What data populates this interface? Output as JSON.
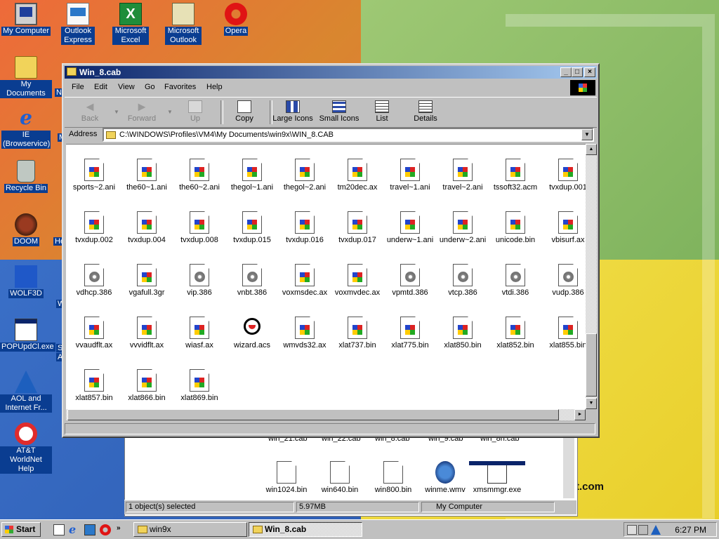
{
  "desktop": {
    "icons": [
      {
        "label": "My Computer",
        "icon": "my-computer-icon"
      },
      {
        "label": "Outlook Express",
        "icon": "outlook-express-icon"
      },
      {
        "label": "Microsoft Excel",
        "icon": "excel-icon"
      },
      {
        "label": "Microsoft Outlook",
        "icon": "outlook-icon"
      },
      {
        "label": "Opera",
        "icon": "opera-icon"
      },
      {
        "label": "My Documents",
        "icon": "my-documents-icon"
      },
      {
        "label": "IE (Browservice)",
        "icon": "ie-icon"
      },
      {
        "label": "Recycle Bin",
        "icon": "recycle-bin-icon"
      },
      {
        "label": "DOOM",
        "icon": "doom-icon"
      },
      {
        "label": "WOLF3D",
        "icon": "wolf3d-icon"
      },
      {
        "label": "POPUpdCl.exe",
        "icon": "exe-icon"
      },
      {
        "label": "AOL and Internet Fr...",
        "icon": "aol-icon"
      },
      {
        "label": "AT&T WorldNet Help",
        "icon": "att-icon"
      }
    ],
    "partial_labels": [
      "Ne",
      "He",
      "W",
      "M",
      "S",
      "A"
    ],
    "wallpaper_text": "t.com"
  },
  "back_window": {
    "row1": [
      "win_21.cab",
      "win_22.cab",
      "win_8.cab",
      "win_9.cab",
      "win_8n.cab"
    ],
    "files": [
      "win1024.bin",
      "win640.bin",
      "win800.bin",
      "winme.wmv",
      "xmsmmgr.exe"
    ],
    "status": {
      "selected": "1 object(s) selected",
      "size": "5.97MB",
      "location": "My Computer"
    }
  },
  "window": {
    "title": "Win_8.cab",
    "menu": [
      "File",
      "Edit",
      "View",
      "Go",
      "Favorites",
      "Help"
    ],
    "toolbar": {
      "back": "Back",
      "forward": "Forward",
      "up": "Up",
      "copy": "Copy",
      "large_icons": "Large Icons",
      "small_icons": "Small Icons",
      "list": "List",
      "details": "Details"
    },
    "address_label": "Address",
    "address": "C:\\WINDOWS\\Profiles\\VM4\\My Documents\\win9x\\WIN_8.CAB"
  },
  "files": [
    {
      "name": "sports~2.ani",
      "type": "win"
    },
    {
      "name": "the60~1.ani",
      "type": "win"
    },
    {
      "name": "the60~2.ani",
      "type": "win"
    },
    {
      "name": "thegol~1.ani",
      "type": "win"
    },
    {
      "name": "thegol~2.ani",
      "type": "win"
    },
    {
      "name": "tm20dec.ax",
      "type": "win"
    },
    {
      "name": "travel~1.ani",
      "type": "win"
    },
    {
      "name": "travel~2.ani",
      "type": "win"
    },
    {
      "name": "tssoft32.acm",
      "type": "win"
    },
    {
      "name": "tvxdup.001",
      "type": "win"
    },
    {
      "name": "tvxdup.002",
      "type": "win"
    },
    {
      "name": "tvxdup.004",
      "type": "win"
    },
    {
      "name": "tvxdup.008",
      "type": "win"
    },
    {
      "name": "tvxdup.015",
      "type": "win"
    },
    {
      "name": "tvxdup.016",
      "type": "win"
    },
    {
      "name": "tvxdup.017",
      "type": "win"
    },
    {
      "name": "underw~1.ani",
      "type": "win"
    },
    {
      "name": "underw~2.ani",
      "type": "win"
    },
    {
      "name": "unicode.bin",
      "type": "win"
    },
    {
      "name": "vbisurf.ax",
      "type": "win"
    },
    {
      "name": "vdhcp.386",
      "type": "gear"
    },
    {
      "name": "vgafull.3gr",
      "type": "win"
    },
    {
      "name": "vip.386",
      "type": "gear"
    },
    {
      "name": "vnbt.386",
      "type": "gear"
    },
    {
      "name": "voxmsdec.ax",
      "type": "win"
    },
    {
      "name": "voxmvdec.ax",
      "type": "win"
    },
    {
      "name": "vpmtd.386",
      "type": "gear"
    },
    {
      "name": "vtcp.386",
      "type": "gear"
    },
    {
      "name": "vtdi.386",
      "type": "gear"
    },
    {
      "name": "vudp.386",
      "type": "gear"
    },
    {
      "name": "vvaudflt.ax",
      "type": "win"
    },
    {
      "name": "vvvidflt.ax",
      "type": "win"
    },
    {
      "name": "wiasf.ax",
      "type": "win"
    },
    {
      "name": "wizard.acs",
      "type": "wizard"
    },
    {
      "name": "wmvds32.ax",
      "type": "win"
    },
    {
      "name": "xlat737.bin",
      "type": "win"
    },
    {
      "name": "xlat775.bin",
      "type": "win"
    },
    {
      "name": "xlat850.bin",
      "type": "win"
    },
    {
      "name": "xlat852.bin",
      "type": "win"
    },
    {
      "name": "xlat855.bin",
      "type": "win"
    },
    {
      "name": "xlat857.bin",
      "type": "win"
    },
    {
      "name": "xlat866.bin",
      "type": "win"
    },
    {
      "name": "xlat869.bin",
      "type": "win"
    }
  ],
  "taskbar": {
    "start": "Start",
    "tasks": [
      {
        "label": "win9x",
        "active": false
      },
      {
        "label": "Win_8.cab",
        "active": true
      }
    ],
    "clock": "6:27 PM"
  }
}
